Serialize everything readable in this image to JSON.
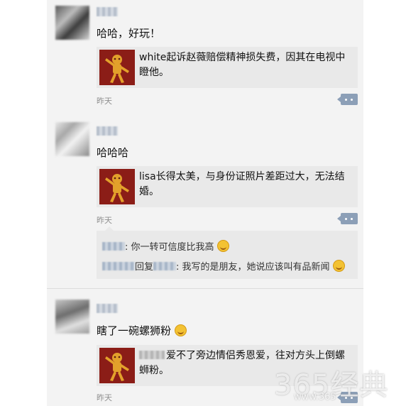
{
  "posts": [
    {
      "text": "哈哈，好玩！",
      "share_title": "white起诉赵薇赔偿精神损失费，因其在电视中瞪他。",
      "time": "昨天"
    },
    {
      "text": "哈哈哈",
      "share_title": "lisa长得太美，与身份证照片差距过大，无法结婚。",
      "time": "昨天",
      "comments": [
        {
          "text": ": 你一转可信度比我高"
        },
        {
          "reply_label": "回复",
          "text": ": 我写的是朋友，她说应该叫有品新闻"
        }
      ]
    },
    {
      "text": "瞎了一碗螺狮粉",
      "share_title": "爱不了旁边情侣秀恩爱，往对方头上倒螺蛳粉。",
      "time": "昨天"
    }
  ],
  "watermark": "365经典",
  "watermark_sub": "www.365"
}
